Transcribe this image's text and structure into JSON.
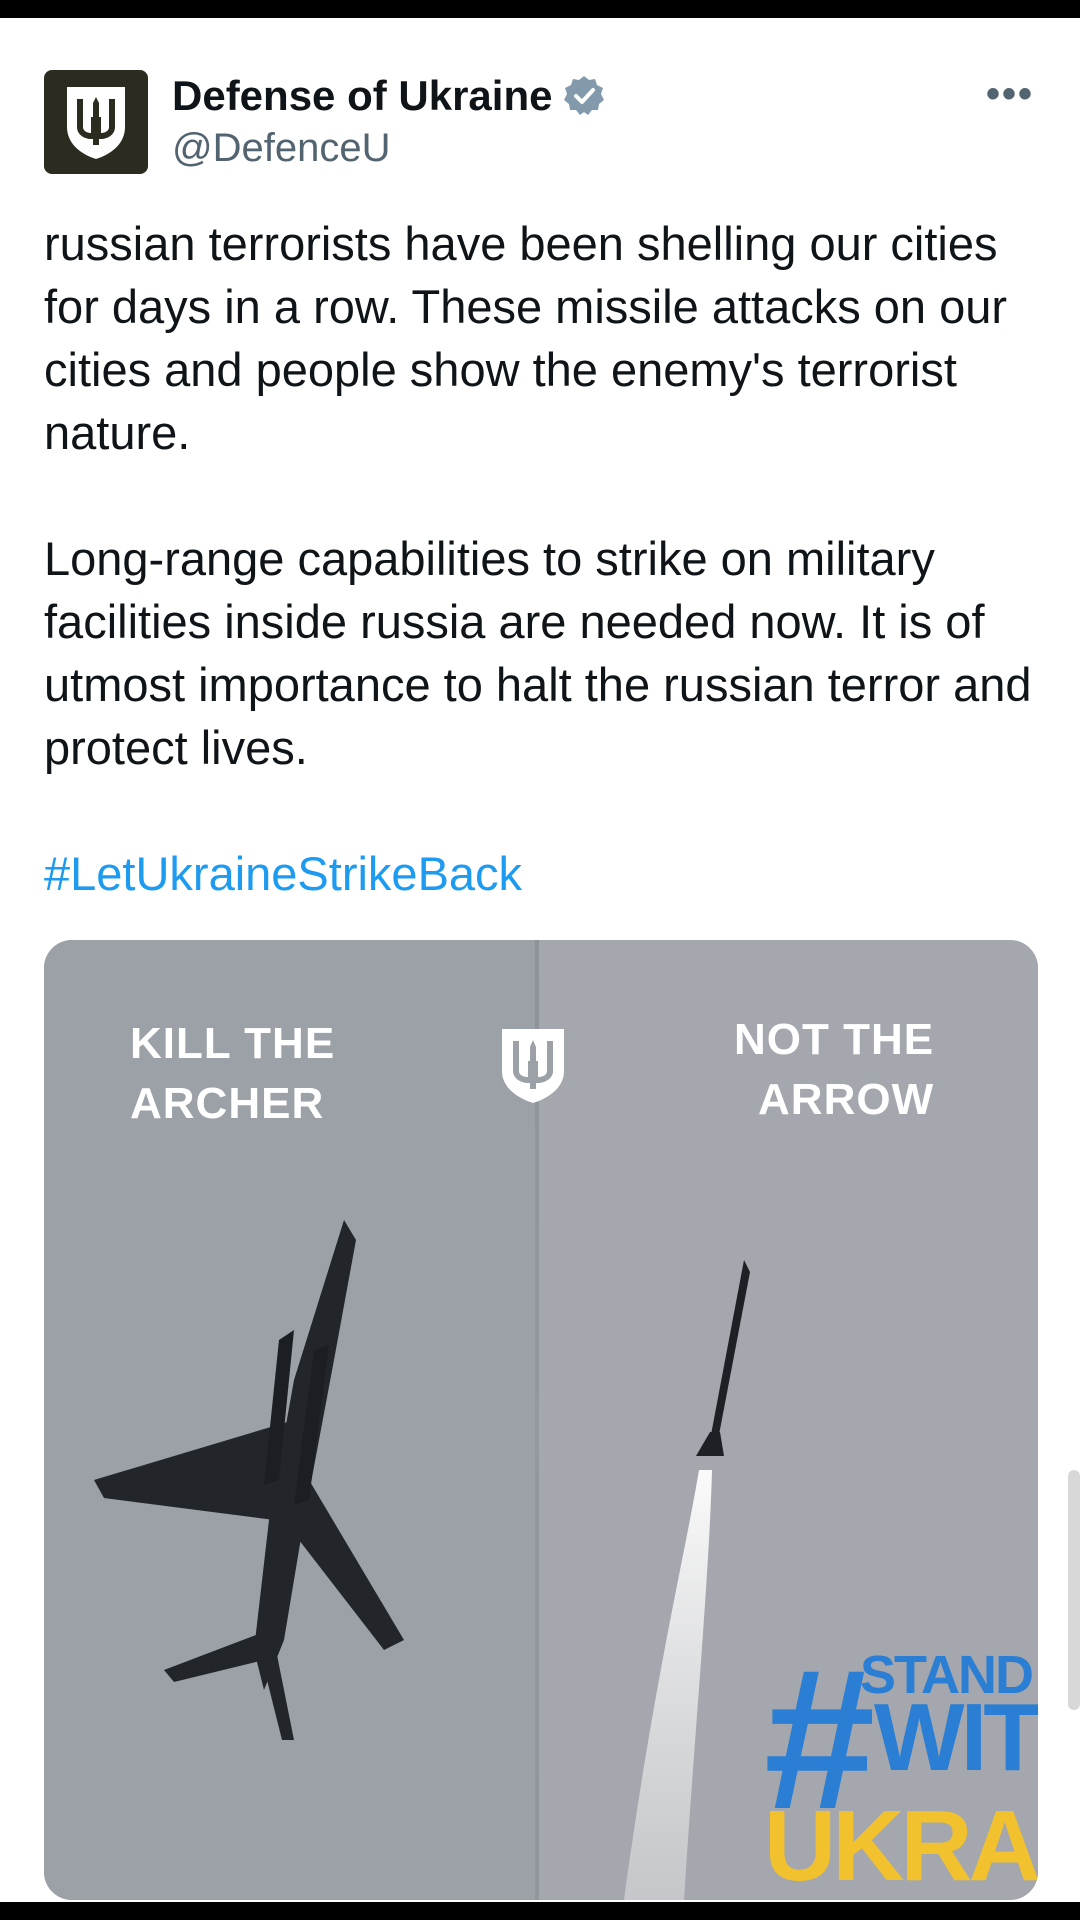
{
  "tweet": {
    "author": {
      "display_name": "Defense of Ukraine",
      "handle": "@DefenceU",
      "verified": true,
      "avatar_icon": "trident-icon"
    },
    "more_label": "•••",
    "paragraphs": [
      "russian terrorists have been shelling our cities for days in a row. These missile attacks on our cities and people show the enemy's terrorist nature.",
      "Long-range capabilities to strike on military facilities inside russia are needed now. It is of utmost importance to halt the russian terror and protect lives."
    ],
    "hashtag": "#LetUkraineStrikeBack",
    "media": {
      "left_caption_line1": "KILL THE",
      "left_caption_line2": "ARCHER",
      "right_caption_line1": "NOT THE",
      "right_caption_line2": "ARROW",
      "badge_hash": "#",
      "badge_word1": "STAND",
      "badge_word2": "WITH",
      "badge_word3": "UKRAINE"
    }
  },
  "colors": {
    "link": "#1d9bf0",
    "verified": "#829aab",
    "avatar_bg": "#2b2b1f",
    "badge_blue": "#2a7fd4",
    "badge_yellow": "#f2c12e"
  }
}
